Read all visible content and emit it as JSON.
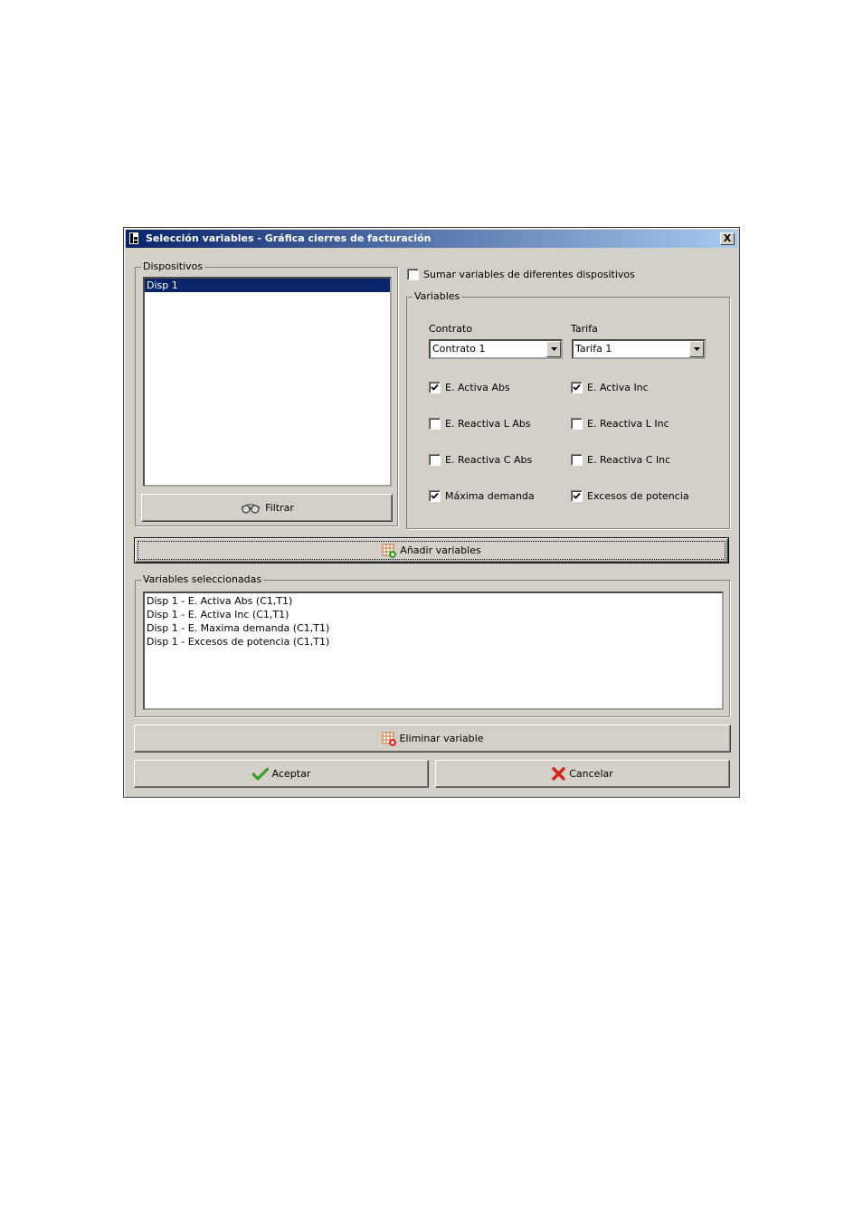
{
  "window": {
    "title": "Selección variables - Gráfica cierres de facturación",
    "close_label": "X"
  },
  "devices": {
    "legend": "Dispositivos",
    "items": [
      "Disp 1"
    ],
    "filter_label": "Filtrar"
  },
  "sum_checkbox": {
    "label": "Sumar variables de diferentes dispositivos",
    "checked": false
  },
  "variables": {
    "legend": "Variables",
    "contract_label": "Contrato",
    "contract_value": "Contrato 1",
    "rate_label": "Tarifa",
    "rate_value": "Tarifa 1",
    "options": [
      {
        "label": "E. Activa Abs",
        "checked": true
      },
      {
        "label": "E. Activa Inc",
        "checked": true
      },
      {
        "label": "E. Reactiva L Abs",
        "checked": false
      },
      {
        "label": "E. Reactiva L Inc",
        "checked": false
      },
      {
        "label": "E. Reactiva C Abs",
        "checked": false
      },
      {
        "label": "E. Reactiva C Inc",
        "checked": false
      },
      {
        "label": "Máxima demanda",
        "checked": true
      },
      {
        "label": "Excesos de potencia",
        "checked": true
      }
    ]
  },
  "add_button": {
    "label": "Añadir variables"
  },
  "selected": {
    "legend": "Variables seleccionadas",
    "items": [
      "Disp 1 - E. Activa Abs (C1,T1)",
      "Disp 1 - E. Activa Inc (C1,T1)",
      "Disp 1 - E. Maxima demanda (C1,T1)",
      "Disp 1 - Excesos de potencia (C1,T1)"
    ]
  },
  "remove_button": {
    "label": "Eliminar variable"
  },
  "accept_button": {
    "label": "Aceptar"
  },
  "cancel_button": {
    "label": "Cancelar"
  },
  "colors": {
    "titlebar_start": "#0a246a",
    "titlebar_end": "#a6caf0",
    "dialog_bg": "#d4d0c8",
    "selection": "#0a246a",
    "accept_icon": "#3a9a2a",
    "cancel_icon": "#d0281e"
  }
}
